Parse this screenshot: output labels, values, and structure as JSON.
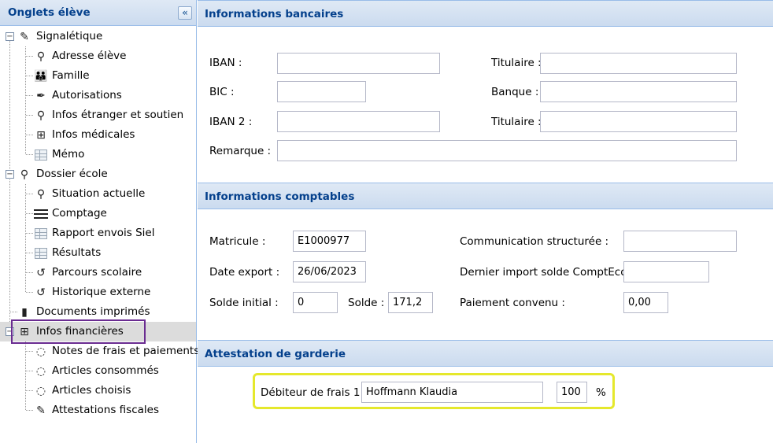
{
  "sidebar": {
    "title": "Onglets élève",
    "collapse_glyph": "«",
    "groups": [
      {
        "label": "Signalétique",
        "icon": "edit-document-icon",
        "items": [
          {
            "label": "Adresse élève",
            "icon": "map-marker-icon"
          },
          {
            "label": "Famille",
            "icon": "family-icon"
          },
          {
            "label": "Autorisations",
            "icon": "pen-icon"
          },
          {
            "label": "Infos étranger et soutien",
            "icon": "pin-icon"
          },
          {
            "label": "Infos médicales",
            "icon": "medical-icon"
          },
          {
            "label": "Mémo",
            "icon": "grid-icon"
          }
        ]
      },
      {
        "label": "Dossier école",
        "icon": "map-marker-icon",
        "items": [
          {
            "label": "Situation actuelle",
            "icon": "magnifier-icon"
          },
          {
            "label": "Comptage",
            "icon": "menu-lines-icon"
          },
          {
            "label": "Rapport envois Siel",
            "icon": "grid-icon"
          },
          {
            "label": "Résultats",
            "icon": "grid-icon"
          },
          {
            "label": "Parcours scolaire",
            "icon": "history-icon"
          },
          {
            "label": "Historique externe",
            "icon": "history-icon"
          }
        ]
      },
      {
        "label": "Documents imprimés",
        "icon": "printer-icon",
        "items": []
      },
      {
        "label": "Infos financières",
        "icon": "finance-icon",
        "selected": true,
        "items": [
          {
            "label": "Notes de frais et paiements",
            "icon": "piggy-bank-icon"
          },
          {
            "label": "Articles consommés",
            "icon": "piggy-bank-icon"
          },
          {
            "label": "Articles choisis",
            "icon": "piggy-bank-icon"
          },
          {
            "label": "Attestations fiscales",
            "icon": "edit-document-icon"
          }
        ]
      }
    ]
  },
  "bank": {
    "title": "Informations bancaires",
    "iban_label": "IBAN :",
    "iban_value": "",
    "titulaire_label": "Titulaire :",
    "titulaire_value": "",
    "bic_label": "BIC :",
    "bic_value": "",
    "banque_label": "Banque :",
    "banque_value": "",
    "iban2_label": "IBAN 2 :",
    "iban2_value": "",
    "titulaire2_label": "Titulaire :",
    "titulaire2_value": "",
    "remarque_label": "Remarque :",
    "remarque_value": ""
  },
  "accounting": {
    "title": "Informations comptables",
    "matricule_label": "Matricule :",
    "matricule_value": "E1000977",
    "communication_label": "Communication structurée :",
    "communication_value": "",
    "date_export_label": "Date export :",
    "date_export_value": "26/06/2023",
    "dernier_import_label": "Dernier import solde ComptEco :",
    "dernier_import_value": "",
    "solde_initial_label": "Solde initial :",
    "solde_initial_value": "0",
    "solde_label": "Solde :",
    "solde_value": "171,2",
    "paiement_label": "Paiement convenu :",
    "paiement_value": "0,00"
  },
  "daycare": {
    "title": "Attestation de garderie",
    "debiteur_label": "Débiteur de frais 1 :",
    "debiteur_value": "Hoffmann Klaudia",
    "percent_value": "100",
    "percent_unit": "%"
  },
  "colors": {
    "header_text": "#04408c",
    "selection_outline": "#6a2c91",
    "highlight_outline": "#e5e82c"
  }
}
